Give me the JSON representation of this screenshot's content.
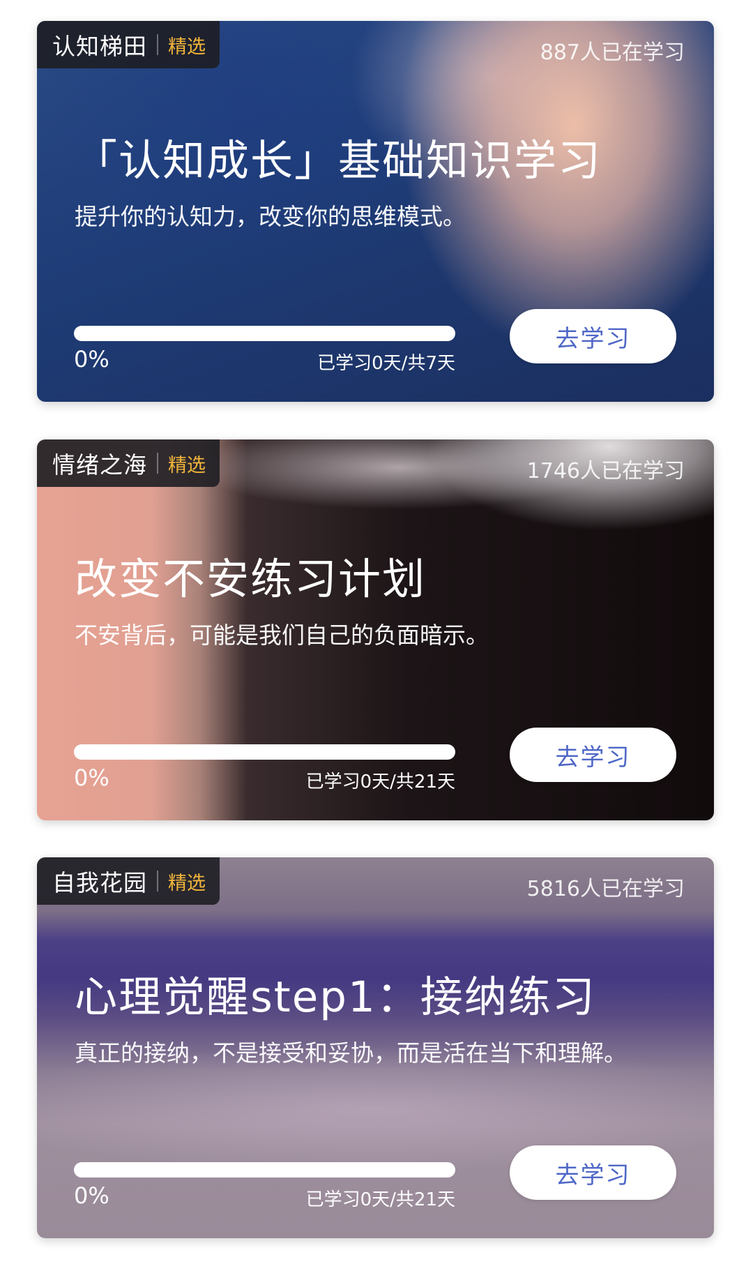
{
  "courses": [
    {
      "category": "认知梯田",
      "badge": "精选",
      "learners": "887人已在学习",
      "title": "「认知成长」基础知识学习",
      "subtitle": "提升你的认知力，改变你的思维模式。",
      "progress_percent": 0,
      "progress_text": "0%",
      "days_text": "已学习0天/共7天",
      "button_label": "去学习"
    },
    {
      "category": "情绪之海",
      "badge": "精选",
      "learners": "1746人已在学习",
      "title": "改变不安练习计划",
      "subtitle": "不安背后，可能是我们自己的负面暗示。",
      "progress_percent": 0,
      "progress_text": "0%",
      "days_text": "已学习0天/共21天",
      "button_label": "去学习"
    },
    {
      "category": "自我花园",
      "badge": "精选",
      "learners": "5816人已在学习",
      "title": "心理觉醒step1：接纳练习",
      "subtitle": "真正的接纳，不是接受和妥协，而是活在当下和理解。",
      "progress_percent": 0,
      "progress_text": "0%",
      "days_text": "已学习0天/共21天",
      "button_label": "去学习"
    }
  ],
  "colors": {
    "badge": "#f2b53a",
    "button_text": "#4f67c7",
    "tag_background": "#1e1e24"
  }
}
